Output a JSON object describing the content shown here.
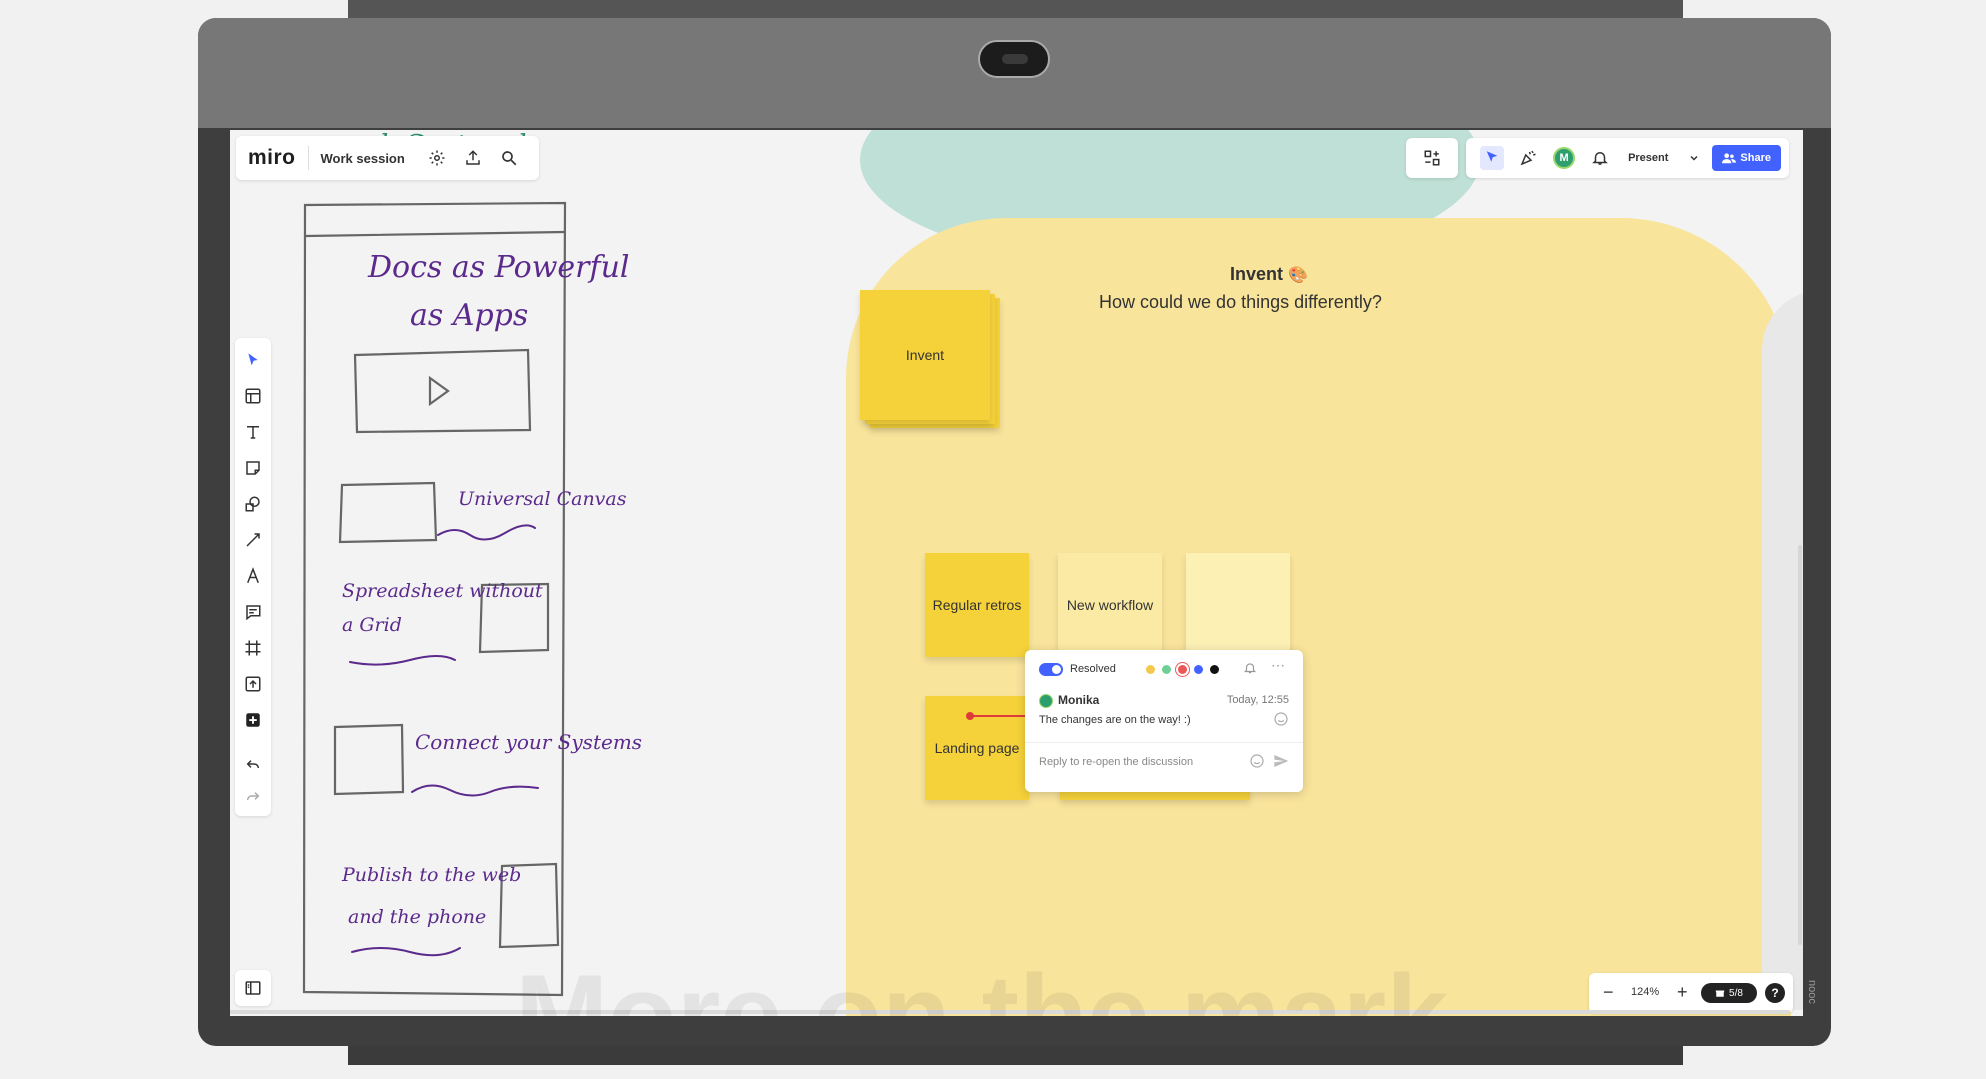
{
  "app": {
    "logo": "miro",
    "board_name": "Work session"
  },
  "header": {
    "present_label": "Present",
    "share_label": "Share",
    "avatar_initial": "M",
    "accent": "#4262ff"
  },
  "canvas": {
    "top_scribble": "k Centered",
    "sketch": {
      "title_line1": "Docs as Powerful",
      "title_line2": "as Apps",
      "item1": "Universal Canvas",
      "item2_line1": "Spreadsheet without",
      "item2_line2": "a Grid",
      "item3": "Connect your Systems",
      "item4_line1": "Publish to the web",
      "item4_line2": "and the phone"
    },
    "frame": {
      "title": "Invent",
      "subtitle": "How could we do things differently?",
      "color": "#f9e49b"
    },
    "stickies": {
      "invent": "Invent",
      "regular_retros": "Regular retros",
      "new_workflow": "New workflow",
      "landing_page": "Landing page"
    }
  },
  "comment": {
    "status": "Resolved",
    "author": "Monika",
    "time": "Today, 12:55",
    "text": "The changes are on the way! :)",
    "reply_placeholder": "Reply to re-open the discussion",
    "colors": [
      "#f2c94c",
      "#6fcf97",
      "#eb5757",
      "#4262ff",
      "#111111"
    ]
  },
  "zoom": {
    "level": "124%",
    "slides": "5/8",
    "help": "?"
  },
  "overlay": {
    "caption": "More on the mark",
    "side_text": "nooc"
  }
}
